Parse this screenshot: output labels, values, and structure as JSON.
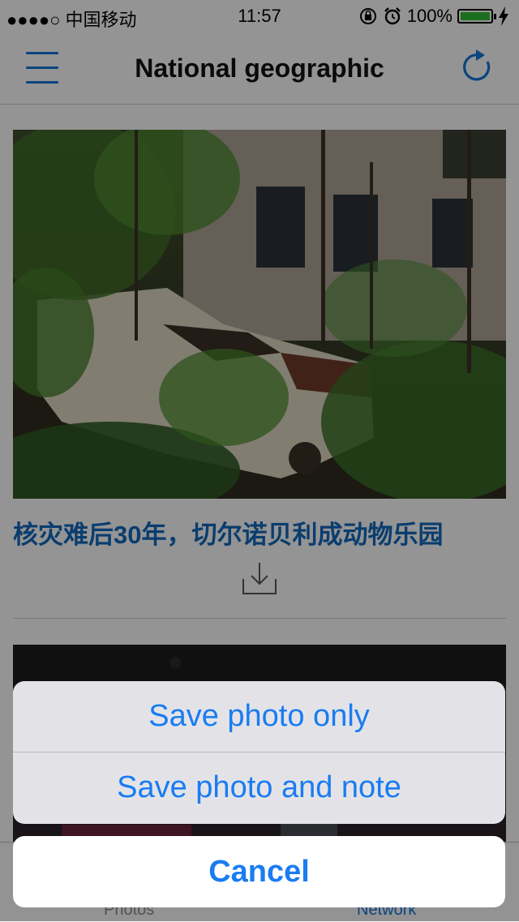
{
  "status_bar": {
    "carrier": "●●●●○ 中国移动",
    "time": "11:57",
    "battery": "100%"
  },
  "nav": {
    "title": "National geographic"
  },
  "article": {
    "title": "核灾难后30年，切尔诺贝利成动物乐园"
  },
  "tabbar": {
    "photos": "Photos",
    "network": "Network"
  },
  "action_sheet": {
    "option1": "Save photo only",
    "option2": "Save photo and note",
    "cancel": "Cancel"
  },
  "colors": {
    "accent": "#1a7cf2",
    "title_blue": "#1266b8",
    "battery_green": "#2db934"
  }
}
